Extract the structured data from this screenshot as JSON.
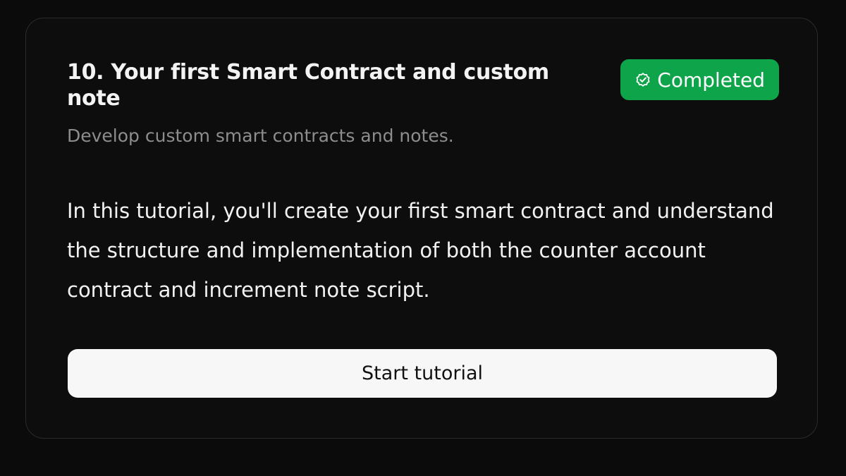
{
  "tutorial": {
    "title": "10. Your first Smart Contract and custom note",
    "status": "Completed",
    "status_icon": "check-circle-icon",
    "subtitle": "Develop custom smart contracts and notes.",
    "description": "In this tutorial, you'll create your first smart contract and understand the structure and implementation of both the counter account contract and increment note script.",
    "button_label": "Start tutorial"
  },
  "colors": {
    "background": "#0b0b0b",
    "card_border": "#2b2b2b",
    "badge": "#0ea44a",
    "button": "#f7f7f7"
  }
}
